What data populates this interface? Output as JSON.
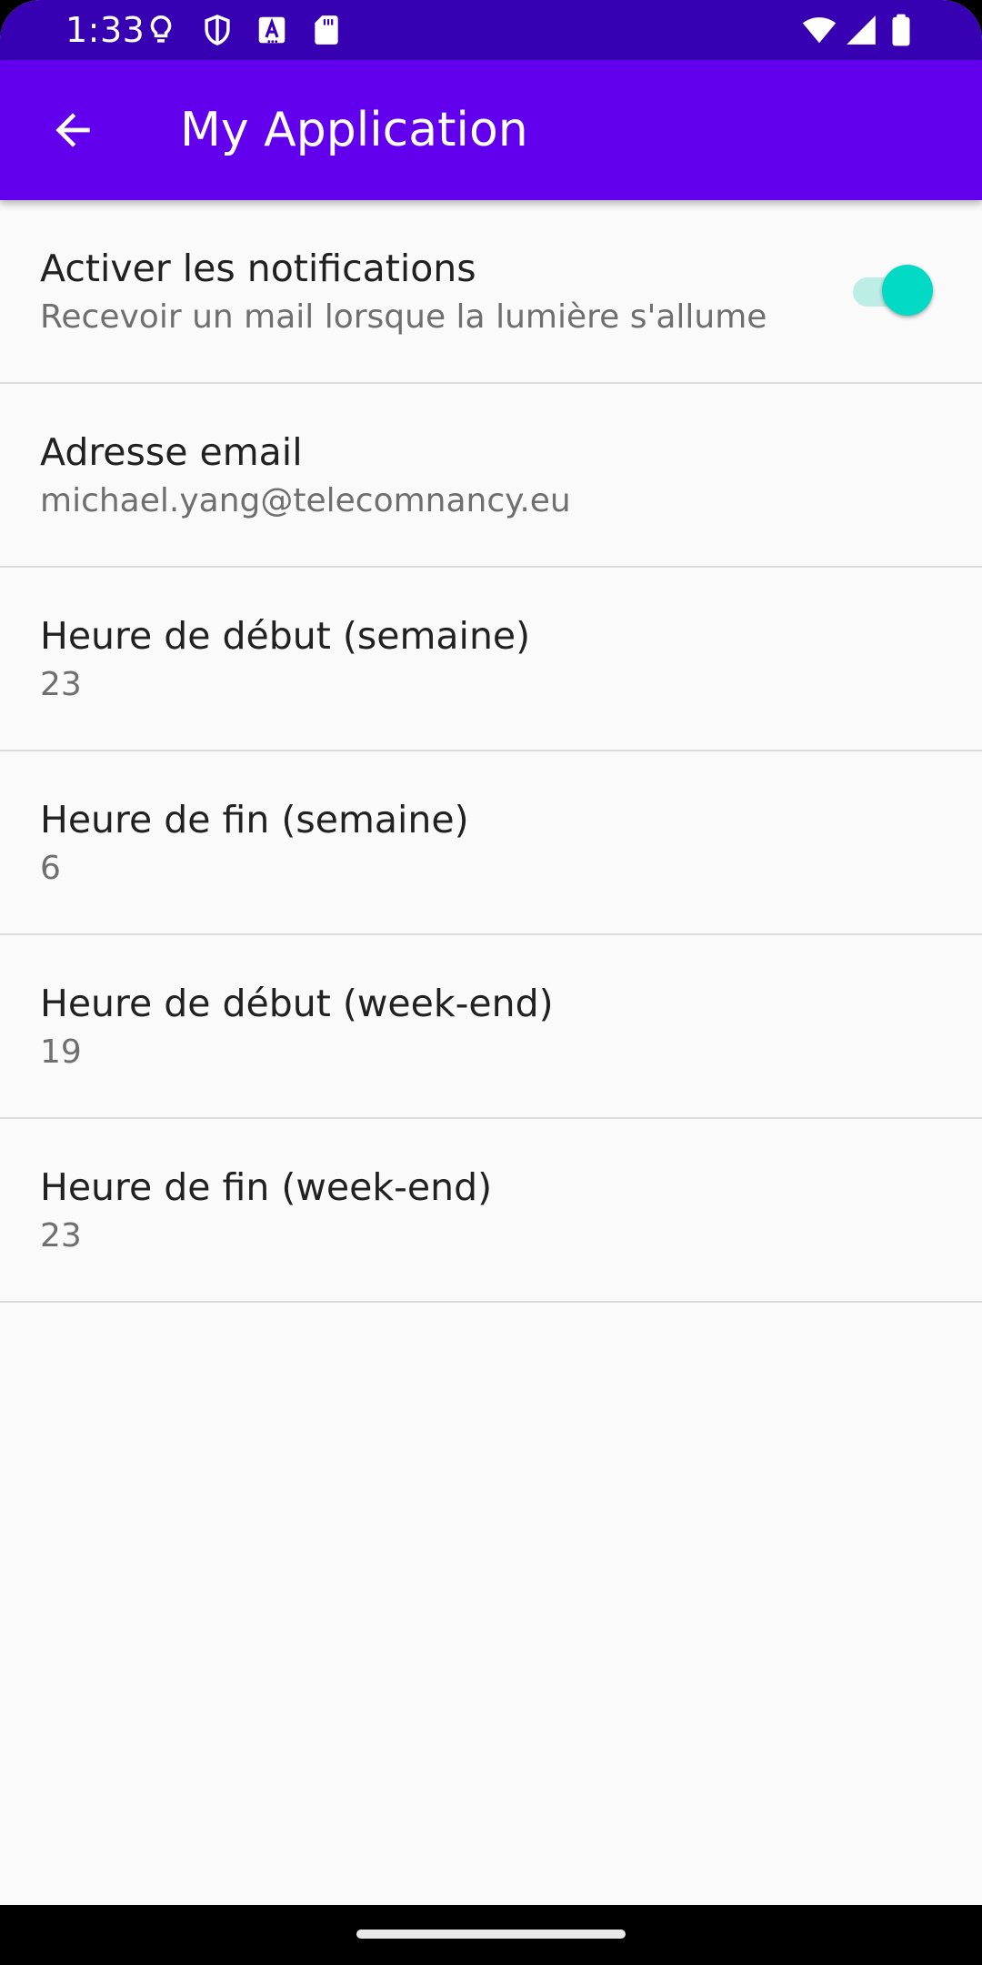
{
  "status_bar": {
    "time": "1:33",
    "left_icons": [
      "lightbulb-icon",
      "shield-icon",
      "font-a-icon",
      "sd-card-icon"
    ],
    "right_icons": [
      "wifi-icon",
      "cell-signal-icon",
      "battery-icon"
    ],
    "background": "#3700b3"
  },
  "app_bar": {
    "title": "My Application",
    "back_icon": "arrow-back-icon",
    "background": "#6200ee"
  },
  "preferences": [
    {
      "title": "Activer les notifications",
      "summary": "Recevoir un mail lorsque la lumière s'allume",
      "toggle": true
    },
    {
      "title": "Adresse email",
      "summary": "michael.yang@telecomnancy.eu"
    },
    {
      "title": "Heure de début (semaine)",
      "summary": "23"
    },
    {
      "title": "Heure de fin (semaine)",
      "summary": "6"
    },
    {
      "title": "Heure de début (week-end)",
      "summary": "19"
    },
    {
      "title": "Heure de fin (week-end)",
      "summary": "23"
    }
  ],
  "colors": {
    "accent": "#03dac5",
    "accent_track": "#bdeee6",
    "primary": "#6200ee",
    "primary_dark": "#3700b3"
  }
}
